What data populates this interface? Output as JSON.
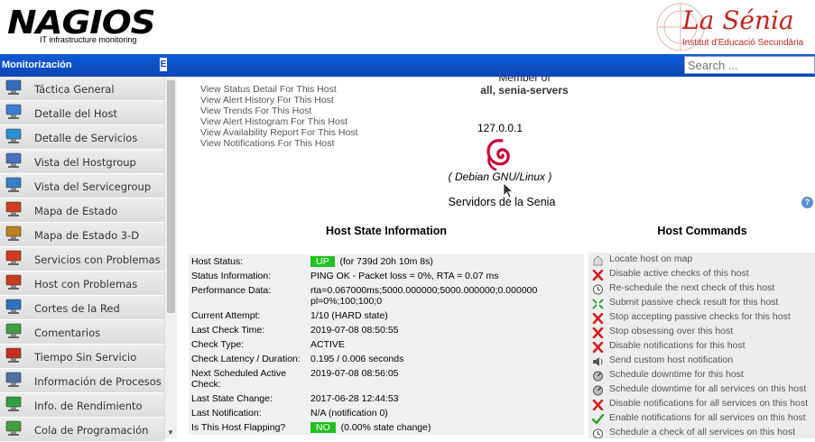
{
  "branding": {
    "nagios_logo_text": "NAGIOS",
    "nagios_tagline": "IT infrastructure monitoring",
    "school_logo_text": "La Sénia",
    "school_subtitle": "Institut d'Educació Secundària",
    "accent_color": "#0a46b5"
  },
  "search": {
    "placeholder": "Search ..."
  },
  "sidebar": {
    "title": "Monitorización",
    "collapse_icon": "E",
    "items": [
      {
        "label": "Táctica General",
        "icon": "monitor-icon"
      },
      {
        "label": "Detalle del Host",
        "icon": "computer-icon"
      },
      {
        "label": "Detalle de Servicios",
        "icon": "services-icon"
      },
      {
        "label": "Vista del Hostgroup",
        "icon": "hostgroup-icon"
      },
      {
        "label": "Vista del Servicegroup",
        "icon": "servicegroup-icon"
      },
      {
        "label": "Mapa de Estado",
        "icon": "status-map-icon"
      },
      {
        "label": "Mapa de Estado 3-D",
        "icon": "status-map-3d-icon"
      },
      {
        "label": "Servicios con Problemas",
        "icon": "service-problems-icon"
      },
      {
        "label": "Host con Problemas",
        "icon": "host-problems-icon"
      },
      {
        "label": "Cortes de la Red",
        "icon": "network-outages-icon"
      },
      {
        "label": "Comentarios",
        "icon": "comments-icon"
      },
      {
        "label": "Tiempo Sin Servicio",
        "icon": "downtime-icon"
      },
      {
        "label": "Información de Procesos",
        "icon": "process-info-icon"
      },
      {
        "label": "Info. de Rendimiento",
        "icon": "performance-icon"
      },
      {
        "label": "Cola de Programación",
        "icon": "scheduling-queue-icon"
      }
    ]
  },
  "host": {
    "links": [
      "View Status Detail For This Host",
      "View Alert History For This Host",
      "View Trends For This Host",
      "View Alert Histogram For This Host",
      "View Availability Report For This Host",
      "View Notifications For This Host"
    ],
    "member_of_label": "Member of",
    "member_groups": "all, senia-servers",
    "address": "127.0.0.1",
    "os": "( Debian GNU/Linux )",
    "alias": "Servidors de la Senia"
  },
  "state": {
    "title": "Host State Information",
    "status_color": "#22c020",
    "rows": [
      {
        "key": "Host Status:",
        "badge": "UP",
        "value": " (for 739d 20h 10m 8s)"
      },
      {
        "key": "Status Information:",
        "value": "PING OK - Packet loss = 0%, RTA = 0.07 ms"
      },
      {
        "key": "Performance Data:",
        "value": "rta=0.067000ms;5000.000000;5000.000000;0.000000 pl=0%;100;100;0"
      },
      {
        "key": "Current Attempt:",
        "value": "1/10  (HARD state)"
      },
      {
        "key": "Last Check Time:",
        "value": "2019-07-08 08:50:55"
      },
      {
        "key": "Check Type:",
        "value": "ACTIVE"
      },
      {
        "key": "Check Latency / Duration:",
        "value": "0.195 / 0.006 seconds"
      },
      {
        "key": "Next Scheduled Active Check:",
        "value": "2019-07-08 08:56:05"
      },
      {
        "key": "Last State Change:",
        "value": "2017-06-28 12:44:53"
      },
      {
        "key": "Last Notification:",
        "value": "N/A (notification 0)"
      },
      {
        "key": "Is This Host Flapping?",
        "badge": "NO",
        "value": " (0.00% state change)"
      }
    ]
  },
  "commands": {
    "title": "Host Commands",
    "items": [
      {
        "label": "Locate host on map",
        "icon": "locate-map-icon"
      },
      {
        "label": "Disable active checks of this host",
        "icon": "disable-x-icon"
      },
      {
        "label": "Re-schedule the next check of this host",
        "icon": "reschedule-clock-icon"
      },
      {
        "label": "Submit passive check result for this host",
        "icon": "passive-check-icon"
      },
      {
        "label": "Stop accepting passive checks for this host",
        "icon": "disable-x-icon"
      },
      {
        "label": "Stop obsessing over this host",
        "icon": "disable-x-icon"
      },
      {
        "label": "Disable notifications for this host",
        "icon": "disable-x-icon"
      },
      {
        "label": "Send custom host notification",
        "icon": "speaker-icon"
      },
      {
        "label": "Schedule downtime for this host",
        "icon": "downtime-clock-icon"
      },
      {
        "label": "Schedule downtime for all services on this host",
        "icon": "downtime-clock-icon"
      },
      {
        "label": "Disable notifications for all services on this host",
        "icon": "disable-x-icon"
      },
      {
        "label": "Enable notifications for all services on this host",
        "icon": "enable-check-icon"
      },
      {
        "label": "Schedule a check of all services on this host",
        "icon": "reschedule-clock-icon"
      }
    ]
  }
}
